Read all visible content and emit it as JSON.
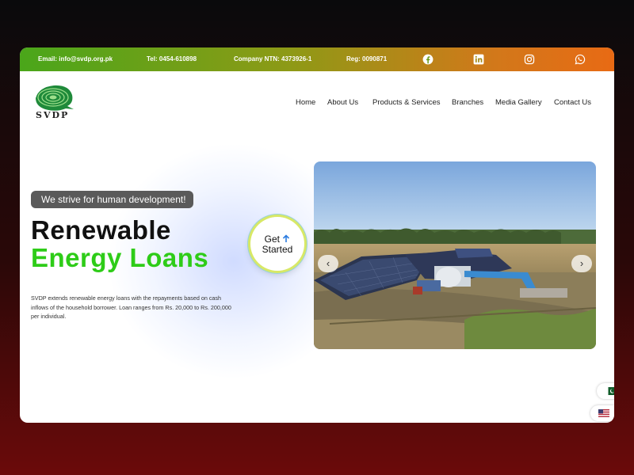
{
  "topbar": {
    "email_label": "Email:",
    "email_value": "info@svdp.org.pk",
    "tel_label": "Tel:",
    "tel_value": "0454-610898",
    "ntn_label": "Company NTN:",
    "ntn_value": "4373926-1",
    "reg_label": "Reg:",
    "reg_value": "0090871",
    "social_icons": [
      "facebook-icon",
      "linkedin-icon",
      "instagram-icon",
      "whatsapp-icon"
    ]
  },
  "brand": {
    "name": "SVDP"
  },
  "nav": {
    "items": [
      {
        "label": "Home"
      },
      {
        "label": "About Us"
      },
      {
        "label": "Products & Services"
      },
      {
        "label": "Branches"
      },
      {
        "label": "Media Gallery"
      },
      {
        "label": "Contact Us"
      }
    ]
  },
  "hero": {
    "tagline": "We strive for human development!",
    "title_line1": "Renewable",
    "title_line2": "Energy Loans",
    "description": "SVDP extends renewable energy loans with the repayments based on cash inflows of the household borrower. Loan ranges from Rs. 20,000 to Rs. 200,000 per individual.",
    "cta_line1": "Get",
    "cta_line2": "Started",
    "slider_prev": "‹",
    "slider_next": "›"
  },
  "colors": {
    "accent_green": "#2ecc18",
    "topbar_start": "#4aa61a",
    "topbar_end": "#e86a14"
  }
}
